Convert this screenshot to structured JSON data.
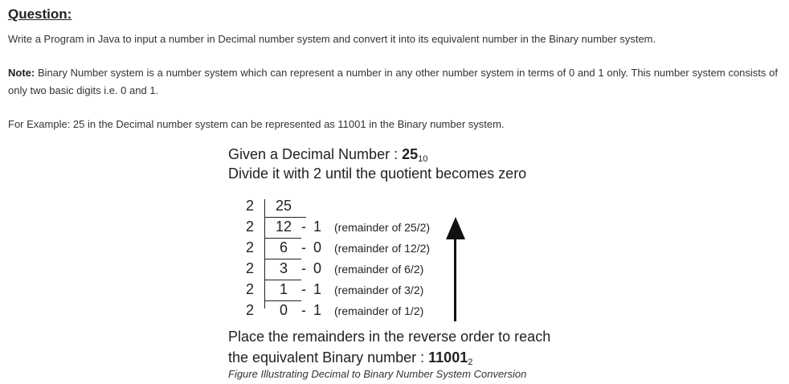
{
  "heading": "Question:",
  "question": "Write a Program in Java to input a number in Decimal number system and convert it into its equivalent number in the Binary number system.",
  "note": {
    "label": "Note:",
    "text": " Binary Number system is a number system which can represent a number in any other number system in terms of 0 and 1 only. This number system consists of only two basic digits i.e. 0 and 1."
  },
  "example": "For Example: 25 in the Decimal number system can be represented as 11001 in the Binary number system.",
  "figure": {
    "given_prefix": "Given a Decimal Number : ",
    "given_number": "25",
    "given_base": "10",
    "divide_text": "Divide it with 2 until the quotient becomes zero",
    "rows": [
      {
        "divisor": "2",
        "quotient": "25",
        "dash": "",
        "remainder": "",
        "note": ""
      },
      {
        "divisor": "2",
        "quotient": "12",
        "dash": "-",
        "remainder": "1",
        "note": "(remainder of 25/2)"
      },
      {
        "divisor": "2",
        "quotient": "6",
        "dash": "-",
        "remainder": "0",
        "note": "(remainder of 12/2)"
      },
      {
        "divisor": "2",
        "quotient": "3",
        "dash": "-",
        "remainder": "0",
        "note": "(remainder of 6/2)"
      },
      {
        "divisor": "2",
        "quotient": "1",
        "dash": "-",
        "remainder": "1",
        "note": "(remainder of 3/2)"
      },
      {
        "divisor": "2",
        "quotient": "0",
        "dash": "-",
        "remainder": "1",
        "note": "(remainder of 1/2)"
      }
    ],
    "place_text": "Place the remainders in the reverse order to reach",
    "equiv_prefix": "the equivalent Binary number : ",
    "equiv_number": "11001",
    "equiv_base": "2",
    "caption": "Figure Illustrating Decimal to Binary Number System Conversion"
  }
}
